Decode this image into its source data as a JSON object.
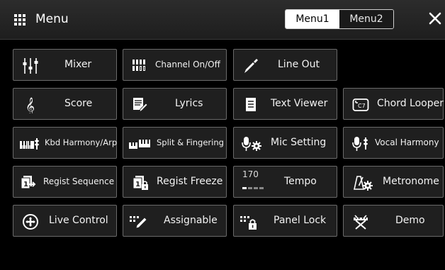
{
  "header": {
    "title": "Menu",
    "tabs": [
      {
        "label": "Menu1",
        "active": true
      },
      {
        "label": "Menu2",
        "active": false
      }
    ]
  },
  "buttons": {
    "mixer": "Mixer",
    "channel_on_off": "Channel On/Off",
    "line_out": "Line Out",
    "score": "Score",
    "lyrics": "Lyrics",
    "text_viewer": "Text Viewer",
    "chord_looper": "Chord Looper",
    "kbd_harmony": "Kbd Harmony/Arp",
    "split_fingering": "Split & Fingering",
    "mic_setting": "Mic Setting",
    "vocal_harmony": "Vocal Harmony",
    "regist_sequence": "Regist Sequence",
    "regist_freeze": "Regist Freeze",
    "tempo": "Tempo",
    "tempo_value": "170",
    "metronome": "Metronome",
    "live_control": "Live Control",
    "assignable": "Assignable",
    "panel_lock": "Panel Lock",
    "demo": "Demo"
  },
  "colors": {
    "background": "#000000",
    "button": "#1f1f1f",
    "border": "#6a6a6a",
    "active_tab": "#ffffff"
  }
}
